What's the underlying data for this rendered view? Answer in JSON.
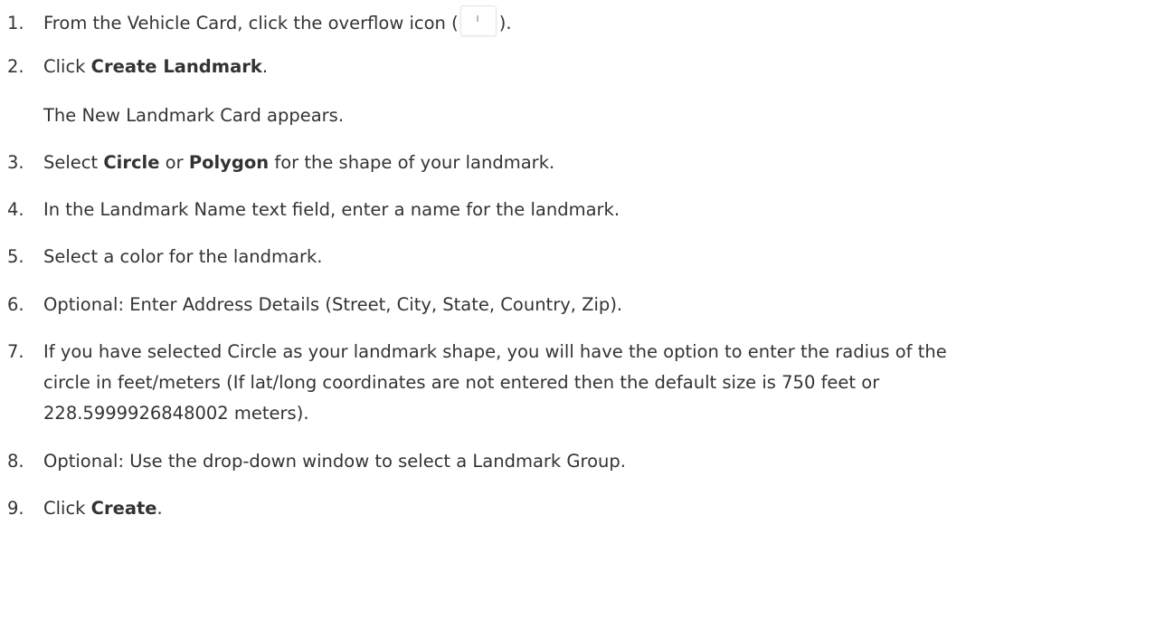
{
  "steps": [
    {
      "num": "1.",
      "pre": "From the Vehicle Card, click the overflow icon (",
      "post": ")."
    },
    {
      "num": "2.",
      "pre": "Click ",
      "bold": "Create Landmark",
      "post": "."
    },
    {
      "note": "The New Landmark Card appears."
    },
    {
      "num": "3.",
      "pre": "Select ",
      "bold1": "Circle",
      "mid": " or ",
      "bold2": "Polygon",
      "post": " for the shape of your landmark."
    },
    {
      "num": "4.",
      "text": "In the Landmark Name text field, enter a name for the landmark."
    },
    {
      "num": "5.",
      "text": "Select a color for the landmark."
    },
    {
      "num": "6.",
      "text": "Optional: Enter Address Details (Street, City, State, Country, Zip)."
    },
    {
      "num": "7.",
      "line1": "If you have selected Circle as your landmark shape, you will have the option to enter the radius of the",
      "line2": "circle in feet/meters (If lat/long coordinates are not entered then the default size is 750 feet or",
      "line3": "228.5999926848002 meters)."
    },
    {
      "num": "8.",
      "text": "Optional: Use the drop-down window to select a Landmark Group."
    },
    {
      "num": "9.",
      "pre": "Click ",
      "bold": "Create",
      "post": "."
    }
  ],
  "icons": {
    "overflow": "vertical-dots-overflow-icon"
  }
}
